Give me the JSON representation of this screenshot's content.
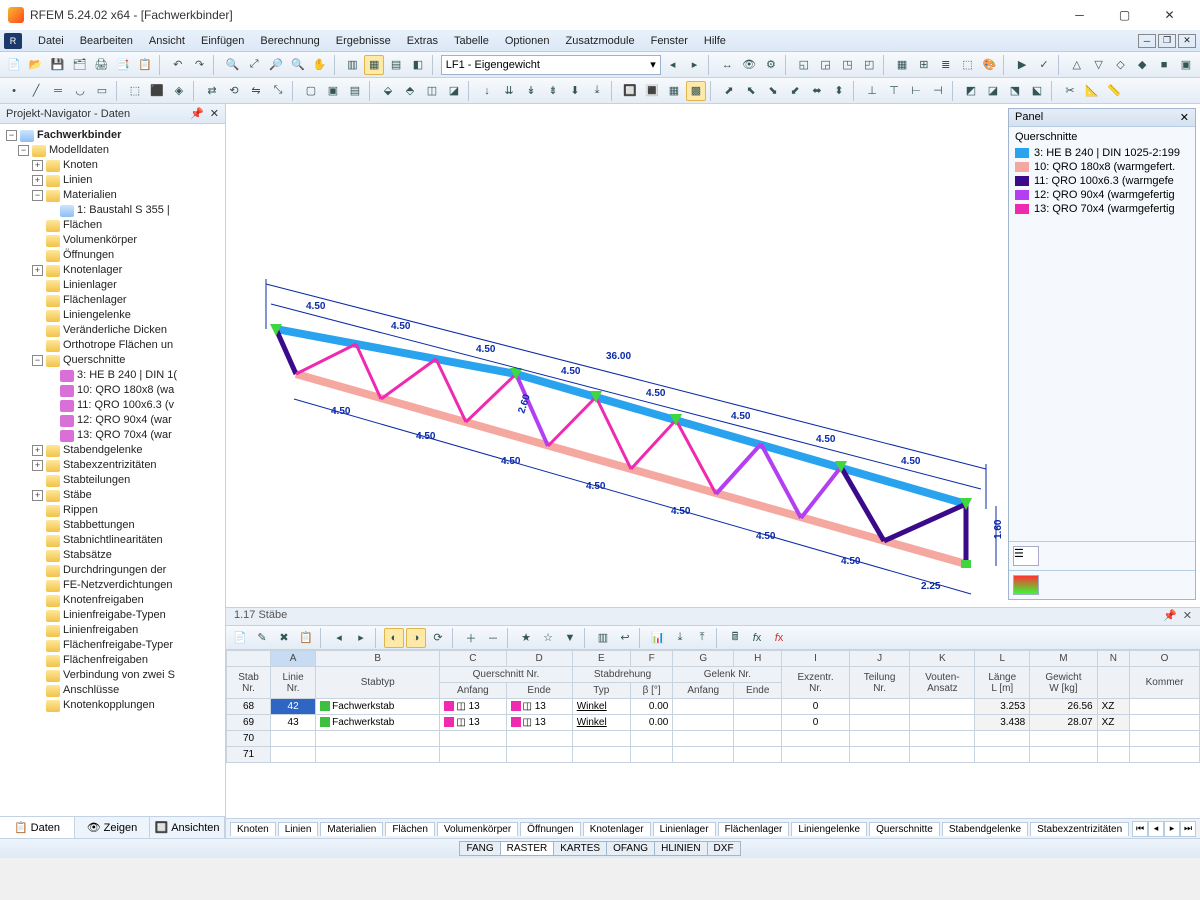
{
  "window": {
    "title": "RFEM 5.24.02 x64 - [Fachwerkbinder]"
  },
  "menu": [
    "Datei",
    "Bearbeiten",
    "Ansicht",
    "Einfügen",
    "Berechnung",
    "Ergebnisse",
    "Extras",
    "Tabelle",
    "Optionen",
    "Zusatzmodule",
    "Fenster",
    "Hilfe"
  ],
  "loadcase_combo": "LF1 - Eigengewicht",
  "navigator": {
    "title": "Projekt-Navigator - Daten",
    "root": "Fachwerkbinder",
    "modeldata": "Modelldaten",
    "items_top": [
      "Knoten",
      "Linien"
    ],
    "materials_label": "Materialien",
    "material_1": "1: Baustahl S 355 |",
    "items_mid": [
      "Flächen",
      "Volumenkörper",
      "Öffnungen",
      "Knotenlager",
      "Linienlager",
      "Flächenlager",
      "Liniengelenke",
      "Veränderliche Dicken",
      "Orthotrope Flächen un"
    ],
    "querschnitte_label": "Querschnitte",
    "querschnitte": [
      "3: HE B 240 | DIN 1(",
      "10: QRO 180x8 (wa",
      "11: QRO 100x6.3 (v",
      "12: QRO 90x4 (war",
      "13: QRO 70x4 (war"
    ],
    "items_bot": [
      "Stabendgelenke",
      "Stabexzentrizitäten",
      "Stabteilungen",
      "Stäbe",
      "Rippen",
      "Stabbettungen",
      "Stabnichtlinearitäten",
      "Stabsätze",
      "Durchdringungen der",
      "FE-Netzverdichtungen",
      "Knotenfreigaben",
      "Linienfreigabe-Typen",
      "Linienfreigaben",
      "Flächenfreigabe-Typer",
      "Flächenfreigaben",
      "Verbindung von zwei S",
      "Anschlüsse",
      "Knotenkopplungen"
    ],
    "tabs": [
      "Daten",
      "Zeigen",
      "Ansichten"
    ]
  },
  "panel": {
    "title": "Panel",
    "section_title": "Querschnitte",
    "legend": [
      {
        "color": "#2aa3ef",
        "label": "3: HE B 240 | DIN 1025-2:199"
      },
      {
        "color": "#f5a8a0",
        "label": "10: QRO 180x8 (warmgefert."
      },
      {
        "color": "#3a0a8a",
        "label": "11: QRO 100x6.3 (warmgefe"
      },
      {
        "color": "#b43ef2",
        "label": "12: QRO 90x4 (warmgefertig"
      },
      {
        "color": "#ef2ab0",
        "label": "13: QRO 70x4 (warmgefertig"
      }
    ]
  },
  "truss": {
    "span_total": "36.00",
    "top_segments": [
      "4.50",
      "4.50",
      "4.50",
      "4.50",
      "4.50",
      "4.50",
      "4.50",
      "4.50"
    ],
    "bot_segments": [
      "4.50",
      "4.50",
      "4.50",
      "4.50",
      "4.50",
      "4.50",
      "4.50",
      "2.25"
    ],
    "height_mid": "2.60",
    "height_end": "1.60"
  },
  "table": {
    "title": "1.17 Stäbe",
    "col_letters": [
      "A",
      "B",
      "C",
      "D",
      "E",
      "F",
      "G",
      "H",
      "I",
      "J",
      "K",
      "L",
      "M",
      "N",
      "O"
    ],
    "headers_row1": [
      "Stab",
      "Linie",
      "",
      "Querschnitt Nr.",
      "",
      "Stabdrehung",
      "",
      "Gelenk Nr.",
      "",
      "Exzentr.",
      "Teilung",
      "Vouten-",
      "Länge",
      "Gewicht",
      "",
      ""
    ],
    "headers_row2": [
      "Nr.",
      "Nr.",
      "Stabtyp",
      "Anfang",
      "Ende",
      "Typ",
      "β [°]",
      "Anfang",
      "Ende",
      "Nr.",
      "Nr.",
      "Ansatz",
      "L [m]",
      "W [kg]",
      "",
      "Kommer"
    ],
    "rows": [
      {
        "stab": "68",
        "linie": "42",
        "typ": "Fachwerkstab",
        "qa": "13",
        "qe": "13",
        "dtyp": "Winkel",
        "beta": "0.00",
        "ga": "",
        "ge": "",
        "ex": "0",
        "te": "",
        "vo": "",
        "len": "3.253",
        "gew": "26.56",
        "xz": "XZ"
      },
      {
        "stab": "69",
        "linie": "43",
        "typ": "Fachwerkstab",
        "qa": "13",
        "qe": "13",
        "dtyp": "Winkel",
        "beta": "0.00",
        "ga": "",
        "ge": "",
        "ex": "0",
        "te": "",
        "vo": "",
        "len": "3.438",
        "gew": "28.07",
        "xz": "XZ"
      },
      {
        "stab": "70"
      },
      {
        "stab": "71"
      }
    ],
    "bottom_tabs": [
      "Knoten",
      "Linien",
      "Materialien",
      "Flächen",
      "Volumenkörper",
      "Öffnungen",
      "Knotenlager",
      "Linienlager",
      "Flächenlager",
      "Liniengelenke",
      "Querschnitte",
      "Stabendgelenke",
      "Stabexzentrizitäten"
    ]
  },
  "statusbar": [
    "FANG",
    "RASTER",
    "KARTES",
    "OFANG",
    "HLINIEN",
    "DXF"
  ],
  "colors": {
    "qs13": "#ef2ab0",
    "qs_green": "#3fbf3f"
  }
}
